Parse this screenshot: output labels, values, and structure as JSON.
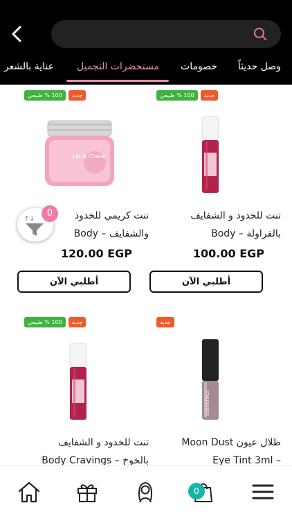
{
  "search": {
    "placeholder": "",
    "value": ""
  },
  "tabs": [
    {
      "label": "وصل حديثاً",
      "active": false
    },
    {
      "label": "خصومات",
      "active": false
    },
    {
      "label": "مستحضرات التجميل",
      "active": true
    },
    {
      "label": "عناية بالشعر",
      "active": false
    }
  ],
  "filter": {
    "count": "0"
  },
  "badges": {
    "new": "جديد",
    "natural": "100 % طبيعي"
  },
  "products": [
    {
      "title_line1": "تنت للخدود و الشفايف",
      "title_line2": "بالفراولة – Body",
      "price": "100.00 EGP",
      "buy_label": "أطلبي الآن"
    },
    {
      "title_line1": "تنت كريمي للخدود",
      "title_line2": "والشفايف – Body",
      "price": "120.00 EGP",
      "buy_label": "أطلبي الآن"
    },
    {
      "title_line1": "ظلال عيون Moon Dust",
      "title_line2": "– Eye Tint 3ml",
      "price": "",
      "buy_label": ""
    },
    {
      "title_line1": "تنت للخدود و الشفايف",
      "title_line2": "بالخوخ – Body Cravings",
      "price": "",
      "buy_label": ""
    }
  ],
  "bottom_nav": {
    "cart_count": "0"
  },
  "colors": {
    "accent_pink": "#ea8fb6",
    "badge_new": "#ee5a2b",
    "badge_natural": "#3fb33f",
    "cart_badge": "#17b5a5"
  }
}
